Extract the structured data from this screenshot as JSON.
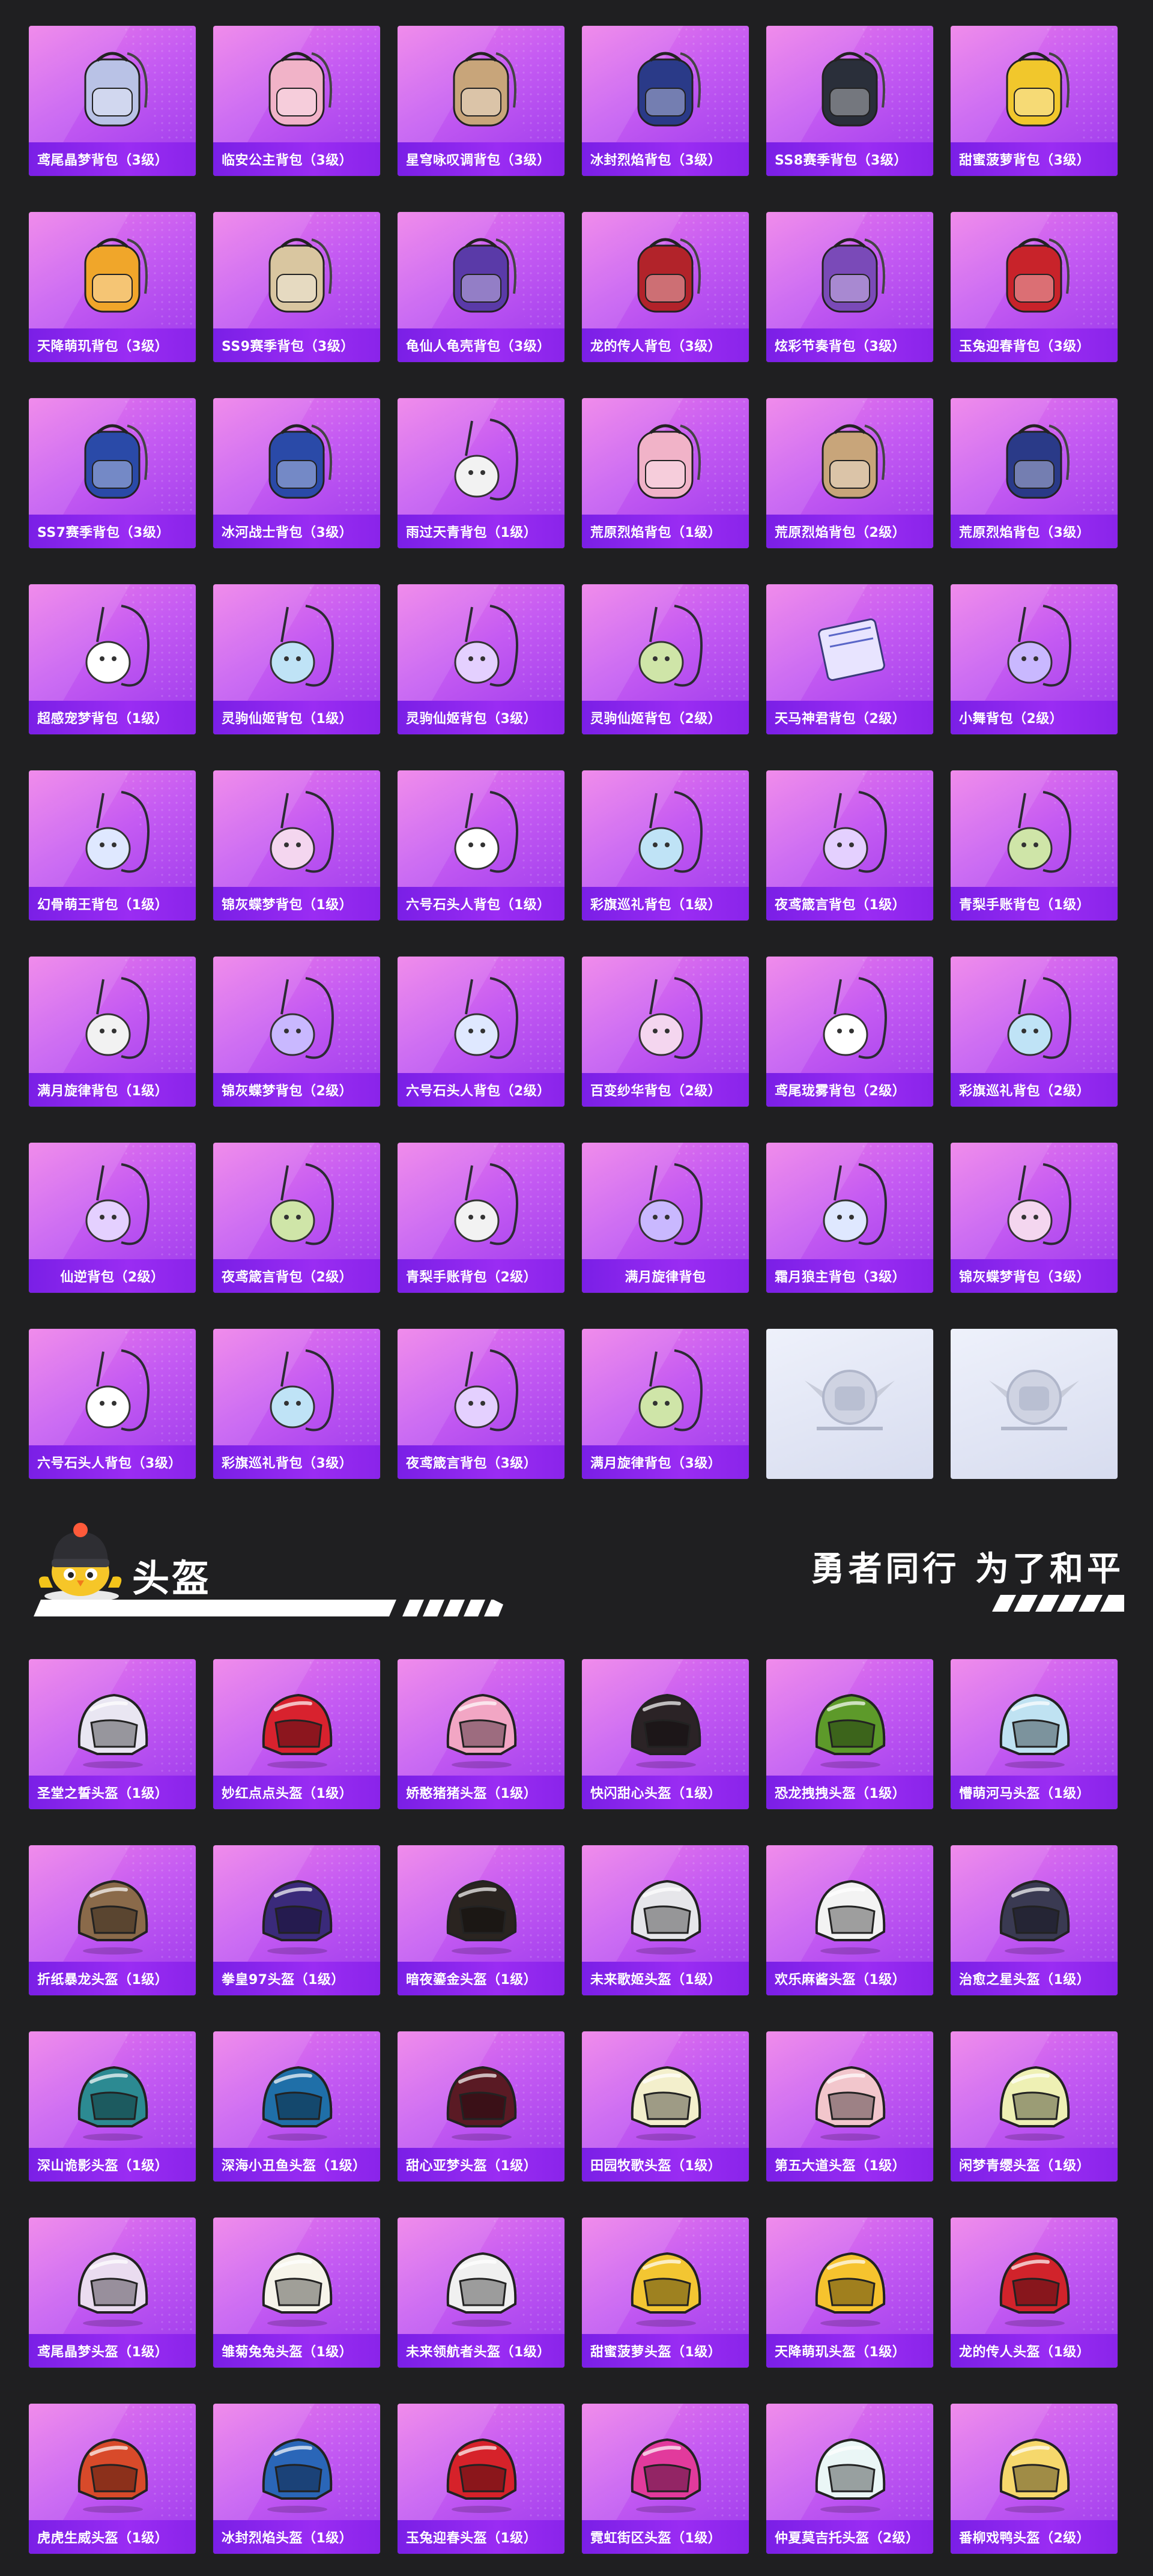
{
  "backpacks": [
    {
      "name": "鸢尾晶梦背包（3级）",
      "icon": "backpack-icon"
    },
    {
      "name": "临安公主背包（3级）",
      "icon": "backpack-icon"
    },
    {
      "name": "星穹咏叹调背包（3级）",
      "icon": "backpack-icon"
    },
    {
      "name": "冰封烈焰背包（3级）",
      "icon": "backpack-icon"
    },
    {
      "name": "SS8赛季背包（3级）",
      "icon": "backpack-icon"
    },
    {
      "name": "甜蜜菠萝背包（3级）",
      "icon": "backpack-icon"
    },
    {
      "name": "天降萌玑背包（3级）",
      "icon": "backpack-icon"
    },
    {
      "name": "SS9赛季背包（3级）",
      "icon": "backpack-icon"
    },
    {
      "name": "龟仙人龟壳背包（3级）",
      "icon": "backpack-icon"
    },
    {
      "name": "龙的传人背包（3级）",
      "icon": "backpack-icon"
    },
    {
      "name": "炫彩节奏背包（3级）",
      "icon": "backpack-icon"
    },
    {
      "name": "玉兔迎春背包（3级）",
      "icon": "backpack-icon"
    },
    {
      "name": "SS7赛季背包（3级）",
      "icon": "backpack-icon"
    },
    {
      "name": "冰河战士背包（3级）",
      "icon": "backpack-icon"
    },
    {
      "name": "雨过天青背包（1级）",
      "icon": "pouch-icon"
    },
    {
      "name": "荒原烈焰背包（1级）",
      "icon": "backpack-icon"
    },
    {
      "name": "荒原烈焰背包（2级）",
      "icon": "backpack-icon"
    },
    {
      "name": "荒原烈焰背包（3级）",
      "icon": "backpack-icon"
    },
    {
      "name": "超感宠梦背包（1级）",
      "icon": "pouch-icon"
    },
    {
      "name": "灵驹仙姬背包（1级）",
      "icon": "pouch-icon"
    },
    {
      "name": "灵驹仙姬背包（3级）",
      "icon": "pouch-icon"
    },
    {
      "name": "灵驹仙姬背包（2级）",
      "icon": "pouch-icon"
    },
    {
      "name": "天马神君背包（2级）",
      "icon": "scroll-icon"
    },
    {
      "name": "小舞背包（2级）",
      "icon": "pouch-icon"
    },
    {
      "name": "幻骨萌王背包（1级）",
      "icon": "pouch-icon"
    },
    {
      "name": "锦灰蝶梦背包（1级）",
      "icon": "pouch-icon"
    },
    {
      "name": "六号石头人背包（1级）",
      "icon": "pouch-icon"
    },
    {
      "name": "彩旗巡礼背包（1级）",
      "icon": "pouch-icon"
    },
    {
      "name": "夜鸢箴言背包（1级）",
      "icon": "pouch-icon"
    },
    {
      "name": "青梨手账背包（1级）",
      "icon": "pouch-icon"
    },
    {
      "name": "满月旋律背包（1级）",
      "icon": "pouch-icon"
    },
    {
      "name": "锦灰蝶梦背包（2级）",
      "icon": "pouch-icon"
    },
    {
      "name": "六号石头人背包（2级）",
      "icon": "pouch-icon"
    },
    {
      "name": "百变纱华背包（2级）",
      "icon": "pouch-icon"
    },
    {
      "name": "鸢尾珑雾背包（2级）",
      "icon": "pouch-icon"
    },
    {
      "name": "彩旗巡礼背包（2级）",
      "icon": "pouch-icon"
    },
    {
      "name": "仙逆背包（2级）",
      "icon": "pouch-icon"
    },
    {
      "name": "夜鸢箴言背包（2级）",
      "icon": "pouch-icon"
    },
    {
      "name": "青梨手账背包（2级）",
      "icon": "pouch-icon"
    },
    {
      "name": "满月旋律背包",
      "icon": "pouch-icon"
    },
    {
      "name": "霜月狼主背包（3级）",
      "icon": "pouch-icon"
    },
    {
      "name": "锦灰蝶梦背包（3级）",
      "icon": "pouch-icon"
    },
    {
      "name": "六号石头人背包（3级）",
      "icon": "pouch-icon"
    },
    {
      "name": "彩旗巡礼背包（3级）",
      "icon": "pouch-icon"
    },
    {
      "name": "夜鸢箴言背包（3级）",
      "icon": "pouch-icon"
    },
    {
      "name": "满月旋律背包（3级）",
      "icon": "pouch-icon"
    }
  ],
  "placeholder_count": 2,
  "helmet_section": {
    "title": "头盔",
    "slogan": "勇者同行 为了和平"
  },
  "helmets": [
    {
      "name": "圣堂之誓头盔（1级）",
      "color": "#e9e6f2"
    },
    {
      "name": "妙红点点头盔（1级）",
      "color": "#d8222e"
    },
    {
      "name": "娇憨猪猪头盔（1级）",
      "color": "#f2a6c4"
    },
    {
      "name": "快闪甜心头盔（1级）",
      "color": "#2b2326"
    },
    {
      "name": "恐龙拽拽头盔（1级）",
      "color": "#5d9a2a"
    },
    {
      "name": "懵萌河马头盔（1级）",
      "color": "#bfe2f2"
    },
    {
      "name": "折纸暴龙头盔（1级）",
      "color": "#8a6a4a"
    },
    {
      "name": "拳皇97头盔（1级）",
      "color": "#3a2a7a"
    },
    {
      "name": "暗夜鎏金头盔（1级）",
      "color": "#2a2420"
    },
    {
      "name": "未来歌姬头盔（1级）",
      "color": "#e6e6ea"
    },
    {
      "name": "欢乐麻酱头盔（1级）",
      "color": "#f3f3f3"
    },
    {
      "name": "治愈之星头盔（1级）",
      "color": "#3a3a52"
    },
    {
      "name": "深山诡影头盔（1级）",
      "color": "#2c8a92"
    },
    {
      "name": "深海小丑鱼头盔（1级）",
      "color": "#1f6fa8"
    },
    {
      "name": "甜心亚梦头盔（1级）",
      "color": "#5a1a24"
    },
    {
      "name": "田园牧歌头盔（1级）",
      "color": "#f3efcc"
    },
    {
      "name": "第五大道头盔（1级）",
      "color": "#f2c6cc"
    },
    {
      "name": "闲梦青缨头盔（1级）",
      "color": "#eef0b4"
    },
    {
      "name": "鸢尾晶梦头盔（1级）",
      "color": "#eadcf0"
    },
    {
      "name": "雏菊兔兔头盔（1级）",
      "color": "#f6f4ea"
    },
    {
      "name": "未来领航者头盔（1级）",
      "color": "#f0f0f0"
    },
    {
      "name": "甜蜜菠萝头盔（1级）",
      "color": "#f3c632"
    },
    {
      "name": "天降萌玑头盔（1级）",
      "color": "#f6c32e"
    },
    {
      "name": "龙的传人头盔（1级）",
      "color": "#d1232b"
    },
    {
      "name": "虎虎生威头盔（1级）",
      "color": "#d84a2a"
    },
    {
      "name": "冰封烈焰头盔（1级）",
      "color": "#2a66b8"
    },
    {
      "name": "玉兔迎春头盔（1级）",
      "color": "#d6222a"
    },
    {
      "name": "霓虹街区头盔（1级）",
      "color": "#e23a9c"
    },
    {
      "name": "仲夏莫吉托头盔（2级）",
      "color": "#eaf6f6"
    },
    {
      "name": "番柳戏鸭头盔（2级）",
      "color": "#f6d86c"
    }
  ]
}
